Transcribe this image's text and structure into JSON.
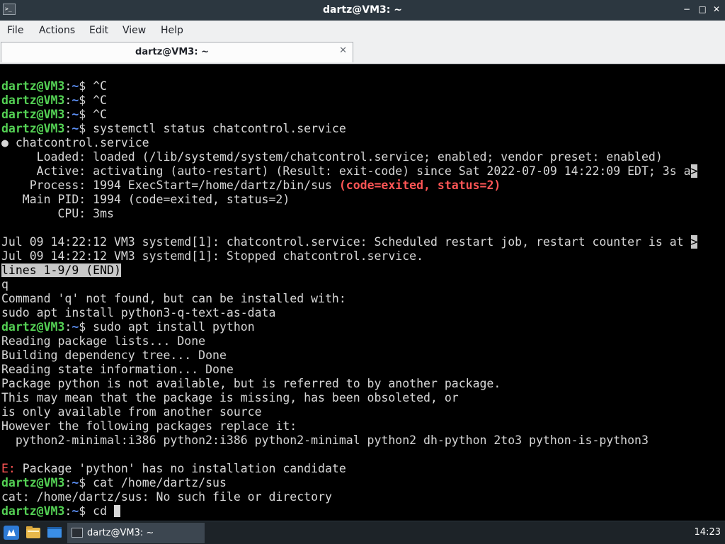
{
  "window": {
    "title": "dartz@VM3: ~",
    "minimize_glyph": "−",
    "maximize_glyph": "□",
    "close_glyph": "✕"
  },
  "menu": [
    "File",
    "Actions",
    "Edit",
    "View",
    "Help"
  ],
  "tab": {
    "label": "dartz@VM3: ~",
    "close_glyph": "✕"
  },
  "prompt": {
    "user": "dartz@VM3",
    "sep": ":",
    "path": "~",
    "sigil": "$ "
  },
  "terminal": {
    "lines": [
      {
        "type": "prompt",
        "cmd": "^C"
      },
      {
        "type": "prompt",
        "cmd": "^C"
      },
      {
        "type": "prompt",
        "cmd": "^C"
      },
      {
        "type": "prompt",
        "cmd": "systemctl status chatcontrol.service"
      },
      {
        "type": "text",
        "text": "● chatcontrol.service"
      },
      {
        "type": "text",
        "text": "     Loaded: loaded (/lib/systemd/system/chatcontrol.service; enabled; vendor preset: enabled)"
      },
      {
        "type": "trunc",
        "text": "     Active: activating (auto-restart) (Result: exit-code) since Sat 2022-07-09 14:22:09 EDT; 3s a",
        "marker": ">"
      },
      {
        "type": "red",
        "text": "    Process: 1994 ExecStart=/home/dartz/bin/sus ",
        "red": "(code=exited, status=2)"
      },
      {
        "type": "text",
        "text": "   Main PID: 1994 (code=exited, status=2)"
      },
      {
        "type": "text",
        "text": "        CPU: 3ms"
      },
      {
        "type": "blank",
        "text": ""
      },
      {
        "type": "trunc",
        "text": "Jul 09 14:22:12 VM3 systemd[1]: chatcontrol.service: Scheduled restart job, restart counter is at ",
        "marker": ">"
      },
      {
        "type": "text",
        "text": "Jul 09 14:22:12 VM3 systemd[1]: Stopped chatcontrol.service."
      },
      {
        "type": "hl",
        "text": "lines 1-9/9 (END)"
      },
      {
        "type": "text",
        "text": "q"
      },
      {
        "type": "text",
        "text": "Command 'q' not found, but can be installed with:"
      },
      {
        "type": "text",
        "text": "sudo apt install python3-q-text-as-data"
      },
      {
        "type": "prompt",
        "cmd": "sudo apt install python"
      },
      {
        "type": "text",
        "text": "Reading package lists... Done"
      },
      {
        "type": "text",
        "text": "Building dependency tree... Done"
      },
      {
        "type": "text",
        "text": "Reading state information... Done"
      },
      {
        "type": "text",
        "text": "Package python is not available, but is referred to by another package."
      },
      {
        "type": "text",
        "text": "This may mean that the package is missing, has been obsoleted, or"
      },
      {
        "type": "text",
        "text": "is only available from another source"
      },
      {
        "type": "text",
        "text": "However the following packages replace it:"
      },
      {
        "type": "text",
        "text": "  python2-minimal:i386 python2:i386 python2-minimal python2 dh-python 2to3 python-is-python3"
      },
      {
        "type": "blank",
        "text": ""
      },
      {
        "type": "err",
        "label": "E:",
        "text": " Package 'python' has no installation candidate"
      },
      {
        "type": "prompt",
        "cmd": "cat /home/dartz/sus"
      },
      {
        "type": "text",
        "text": "cat: /home/dartz/sus: No such file or directory"
      },
      {
        "type": "prompt-cursor",
        "cmd": "cd "
      }
    ]
  },
  "taskbar": {
    "task_label": "dartz@VM3: ~",
    "clock": "14:23"
  },
  "colors": {
    "prompt_user": "#54d154",
    "prompt_path": "#5b8ef2",
    "error_red": "#ff5555",
    "terminal_bg": "#000000",
    "titlebar_bg": "#2c3740"
  }
}
